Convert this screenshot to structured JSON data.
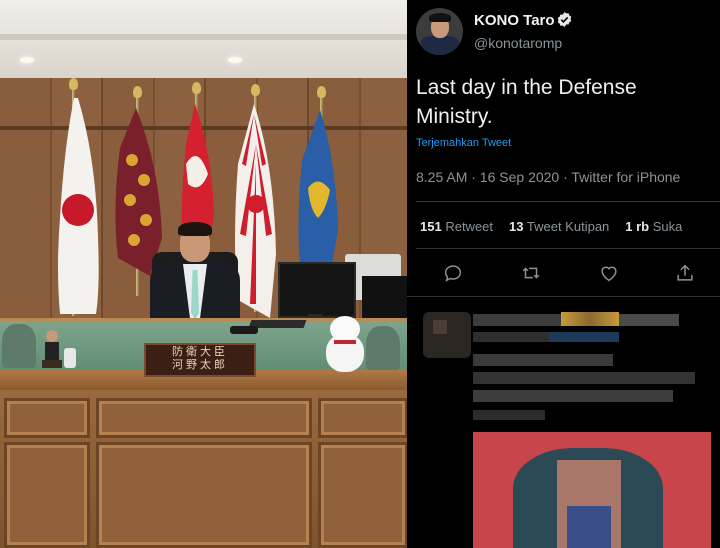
{
  "photo": {
    "nameplate_lines": [
      "防衛大臣",
      "河野太郎"
    ]
  },
  "tweet": {
    "author_name": "KONO Taro",
    "handle": "@konotaromp",
    "text": "Last day in the Defense Ministry.",
    "translate_label": "Terjemahkan Tweet",
    "timestamp": "8.25 AM · 16 Sep 2020 · Twitter for iPhone",
    "stats": {
      "retweets_count": "151",
      "retweets_label": "Retweet",
      "quotes_count": "13",
      "quotes_label": "Tweet Kutipan",
      "likes_count": "1 rb",
      "likes_label": "Suka"
    },
    "actions": [
      "reply-icon",
      "retweet-icon",
      "like-icon",
      "share-icon"
    ]
  },
  "colors": {
    "background": "#000000",
    "text_primary": "#f1f1f1",
    "text_secondary": "#8b949a",
    "link": "#1d9bf0",
    "divider": "#2f3336"
  }
}
